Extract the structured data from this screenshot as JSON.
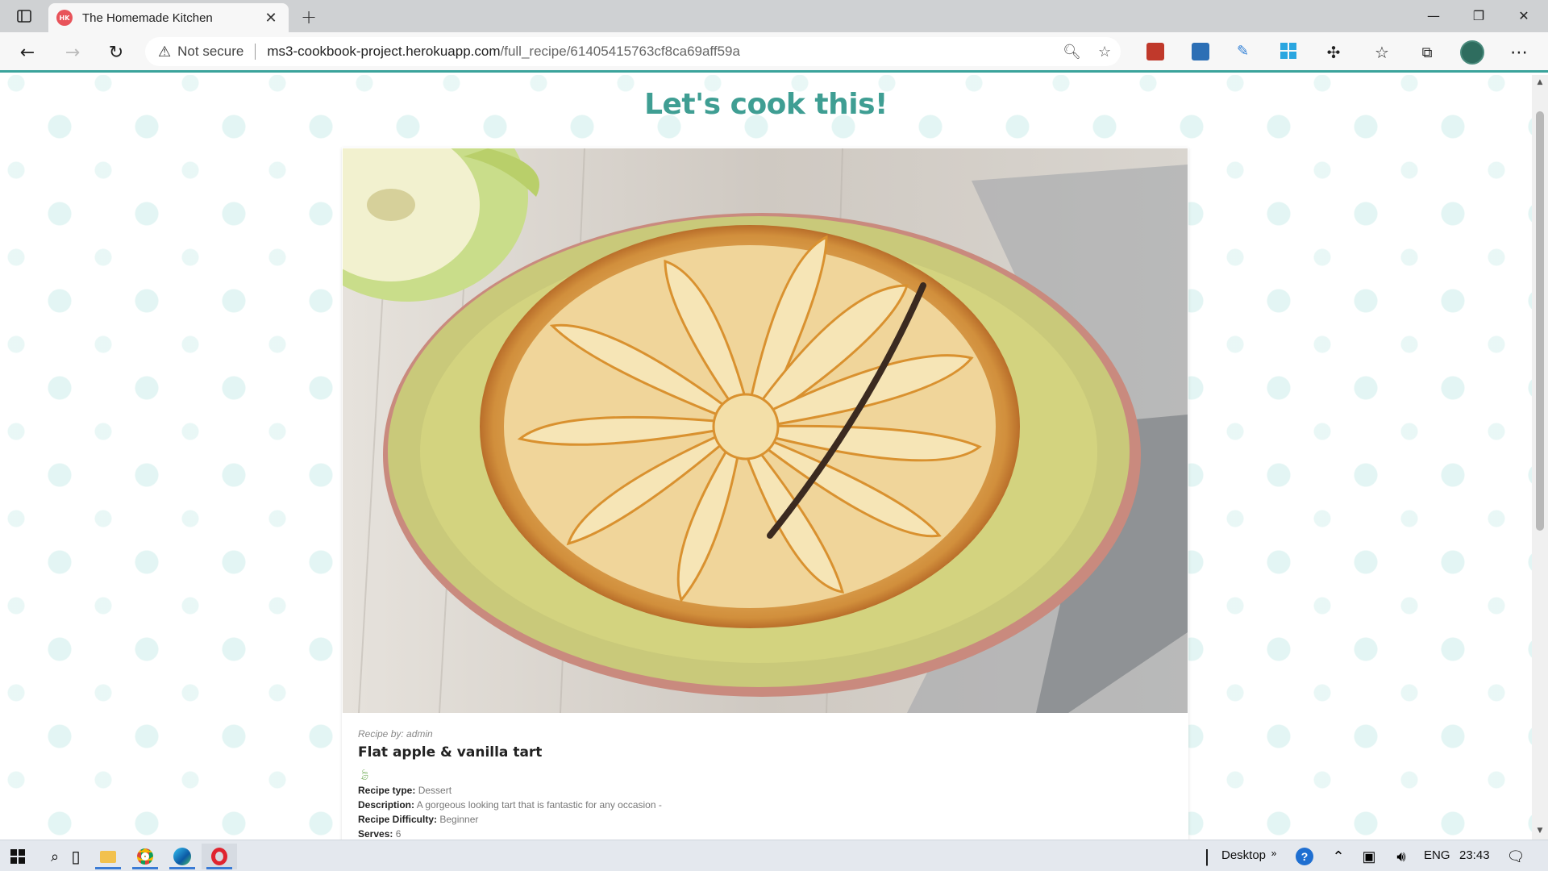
{
  "browser": {
    "tab_title": "The Homemade Kitchen",
    "favicon_text": "HK",
    "security_label": "Not secure",
    "url_host": "ms3-cookbook-project.herokuapp.com",
    "url_path": "/full_recipe/61405415763cf8ca69aff59a",
    "accent_color": "#3aa39b"
  },
  "page": {
    "heading": "Let's cook this!",
    "heading_color": "#3f9e93"
  },
  "recipe": {
    "author_label": "Recipe by: admin",
    "title": "Flat apple & vanilla tart",
    "fields": [
      {
        "label": "Recipe type:",
        "value": "Dessert"
      },
      {
        "label": "Description:",
        "value": "A gorgeous looking tart that is fantastic for any occasion -"
      },
      {
        "label": "Recipe Difficulty:",
        "value": "Beginner"
      },
      {
        "label": "Serves:",
        "value": "6"
      }
    ]
  },
  "taskbar": {
    "desktop_label": "Desktop",
    "language": "ENG",
    "time": "23:43"
  }
}
